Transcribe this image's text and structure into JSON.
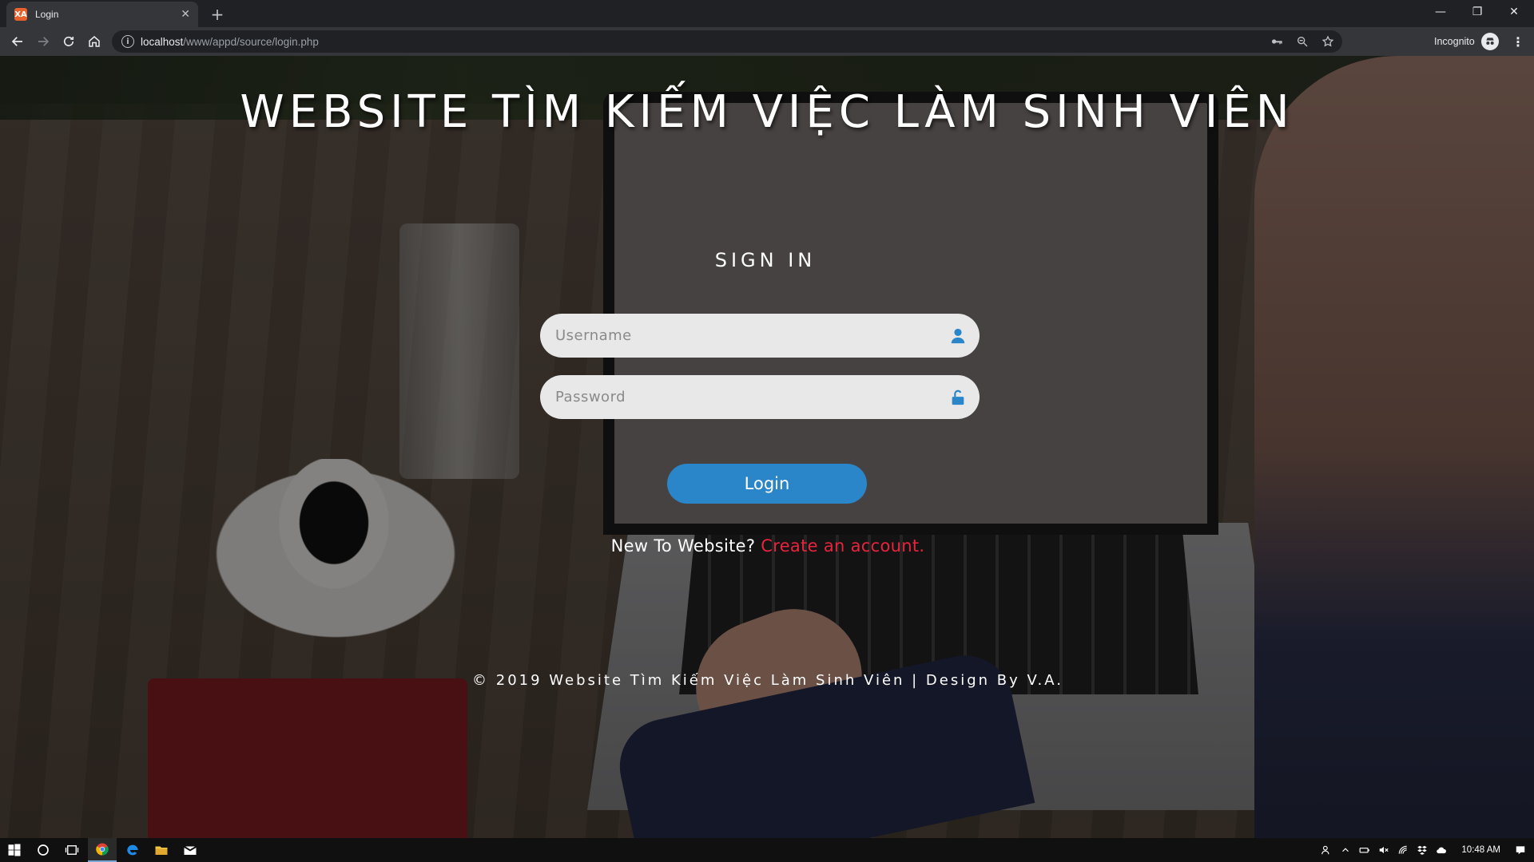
{
  "browser": {
    "tab_title": "Login",
    "tab_favicon": "XA",
    "new_tab_symbol": "+",
    "url_host": "localhost",
    "url_path": "/www/appd/source/login.php",
    "profile_label": "Incognito"
  },
  "page": {
    "site_title": "WEBSITE TÌM KIẾM VIỆC LÀM SINH VIÊN",
    "signin_title": "SIGN IN",
    "username_placeholder": "Username",
    "password_placeholder": "Password",
    "login_label": "Login",
    "signup_prompt": "New To Website?",
    "signup_link": "Create an account.",
    "footer": "© 2019 Website Tìm Kiếm Việc Làm Sinh Viên | Design By V.A."
  },
  "taskbar": {
    "clock": "10:48 AM"
  },
  "colors": {
    "accent": "#2b86c9",
    "link": "#e8243c",
    "field_bg": "#e8e8e8"
  }
}
